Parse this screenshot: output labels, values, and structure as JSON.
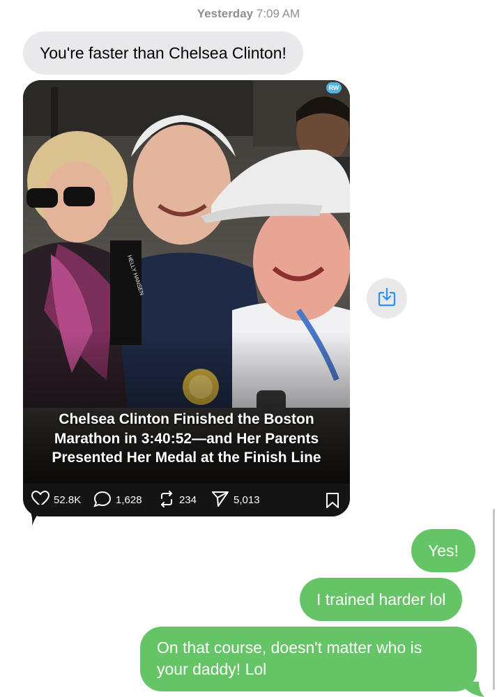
{
  "conversation": {
    "timestamp_day": "Yesterday",
    "timestamp_time": "7:09 AM"
  },
  "incoming": {
    "text": "You're faster than Chelsea Clinton!"
  },
  "shared_post": {
    "badge": "RW",
    "headline_line1": "Chelsea Clinton Finished the Boston",
    "headline_line2": "Marathon in 3:40:52—and Her Parents",
    "headline_line3": "Presented Her Medal at the Finish Line",
    "photo_tag": "HELLY HANSEN",
    "likes": "52.8K",
    "comments": "1,628",
    "reposts": "234",
    "shares": "5,013"
  },
  "outgoing": [
    {
      "text": "Yes!"
    },
    {
      "text": "I trained harder lol"
    },
    {
      "line1": "On that course, doesn't matter who is",
      "line2": "your daddy! Lol"
    }
  ],
  "colors": {
    "incoming_bubble": "#e9e9eb",
    "outgoing_bubble": "#65c466",
    "save_icon": "#2f8ff6",
    "post_footer": "#141414"
  },
  "icons": {
    "save": "save-to-device-icon",
    "like": "heart-icon",
    "comment": "comment-bubble-icon",
    "repost": "repost-arrows-icon",
    "share": "send-icon",
    "bookmark": "bookmark-icon"
  }
}
